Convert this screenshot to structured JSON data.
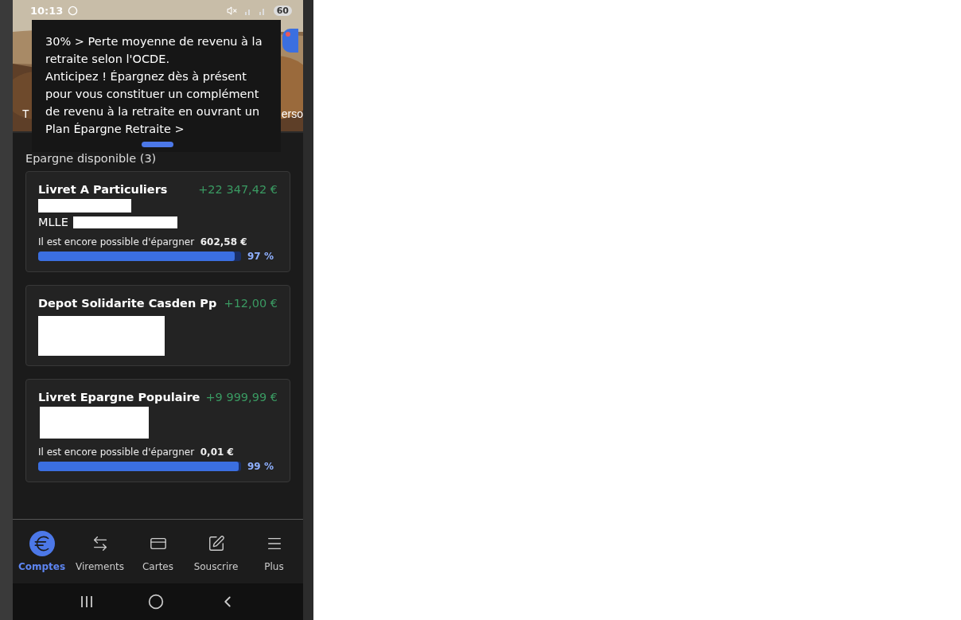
{
  "status_bar": {
    "time": "10:13",
    "battery": "60"
  },
  "hero": {
    "kind": "picture",
    "left_fragment": "T",
    "right_fragment": "erso"
  },
  "promo": {
    "paragraphs": [
      "30% > Perte moyenne de revenu à la retraite selon l'OCDE.",
      "Anticipez ! Épargnez dès à présent pour vous constituer un complément de revenu à la retraite en ouvrant un Plan Épargne Retraite >"
    ]
  },
  "section": {
    "title": "Epargne disponible (3)"
  },
  "accounts": [
    {
      "name": "Livret A Particuliers",
      "amount": "+22 347,42 €",
      "holder": "MLLE",
      "ceiling_text": "Il est encore possible d'épargner",
      "ceiling_amount": "602,58 €",
      "level": 0.97,
      "percent": "97 %"
    },
    {
      "name": "Depot Solidarite Casden Pp",
      "amount": "+12,00 €"
    },
    {
      "name": "Livret Epargne Populaire",
      "amount": "+9 999,99 €",
      "ceiling_text": "Il est encore possible d'épargner",
      "ceiling_amount": "0,01 €",
      "level": 0.99,
      "percent": "99 %"
    }
  ],
  "nav": [
    {
      "label": "Comptes",
      "selected": true
    },
    {
      "label": "Virements",
      "selected": false
    },
    {
      "label": "Cartes",
      "selected": false
    },
    {
      "label": "Souscrire",
      "selected": false
    },
    {
      "label": "Plus",
      "selected": false
    }
  ]
}
